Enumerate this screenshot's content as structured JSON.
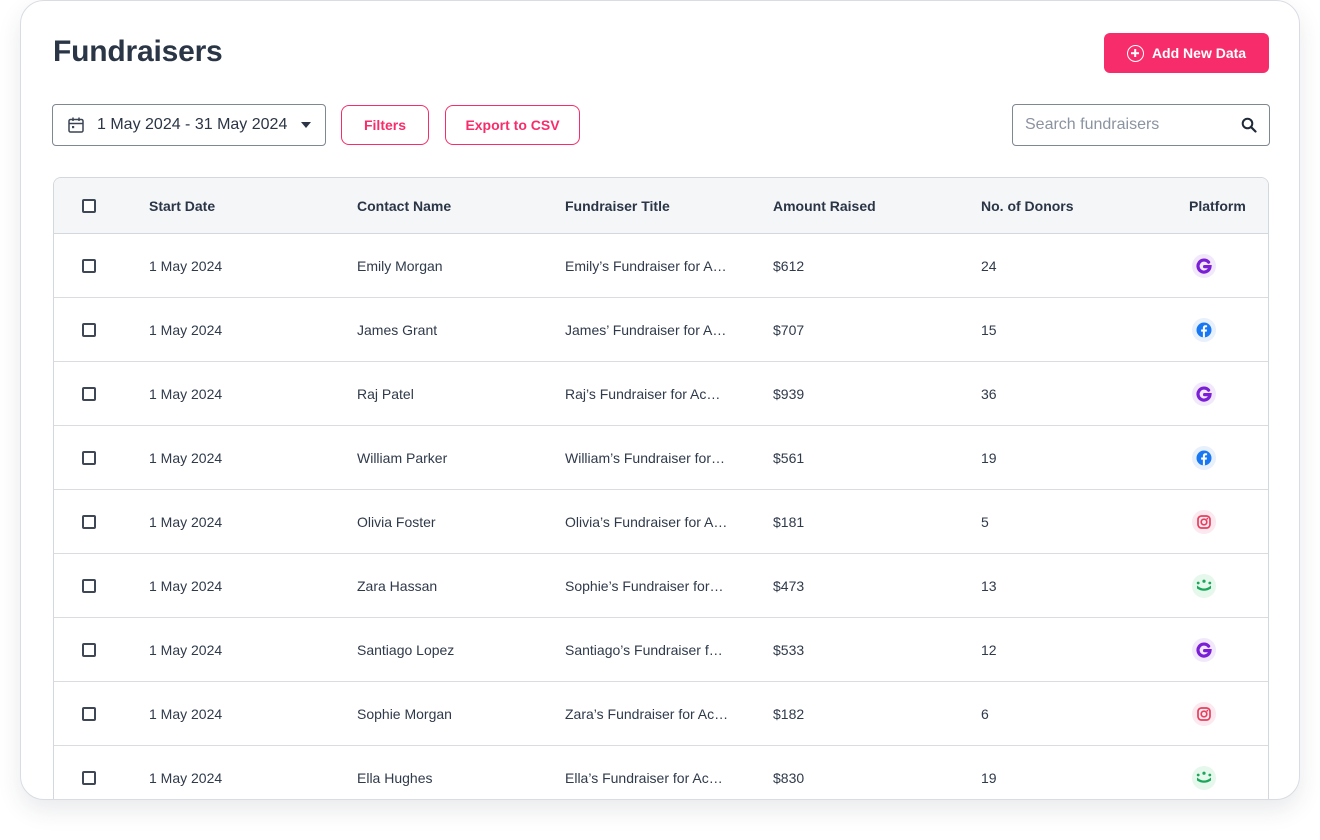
{
  "header": {
    "title": "Fundraisers",
    "add_button_label": "Add New Data"
  },
  "toolbar": {
    "date_range": "1 May 2024 - 31 May 2024",
    "filters_label": "Filters",
    "export_label": "Export to CSV",
    "search_placeholder": "Search fundraisers"
  },
  "colors": {
    "accent": "#f72d6b",
    "gofundme": "#7a1fd6",
    "facebook": "#1877f2",
    "instagram": "#e4405f",
    "justgiving": "#1aa75b"
  },
  "table": {
    "columns": [
      "Start Date",
      "Contact Name",
      "Fundraiser Title",
      "Amount Raised",
      "No. of Donors",
      "Platform"
    ],
    "rows": [
      {
        "start_date": "1 May 2024",
        "contact": "Emily Morgan",
        "title": "Emily’s Fundraiser for A…",
        "amount": "$612",
        "donors": "24",
        "platform": "gofundme-icon"
      },
      {
        "start_date": "1 May 2024",
        "contact": "James Grant",
        "title": "James’ Fundraiser for A…",
        "amount": "$707",
        "donors": "15",
        "platform": "facebook-icon"
      },
      {
        "start_date": "1 May 2024",
        "contact": "Raj Patel",
        "title": "Raj’s Fundraiser for Acm…",
        "amount": "$939",
        "donors": "36",
        "platform": "gofundme-icon"
      },
      {
        "start_date": "1 May 2024",
        "contact": "William Parker",
        "title": "William’s Fundraiser for…",
        "amount": "$561",
        "donors": "19",
        "platform": "facebook-icon"
      },
      {
        "start_date": "1 May 2024",
        "contact": "Olivia Foster",
        "title": "Olivia’s Fundraiser for A…",
        "amount": "$181",
        "donors": "5",
        "platform": "instagram-icon"
      },
      {
        "start_date": "1 May 2024",
        "contact": "Zara Hassan",
        "title": "Sophie’s Fundraiser for…",
        "amount": "$473",
        "donors": "13",
        "platform": "justgiving-icon"
      },
      {
        "start_date": "1 May 2024",
        "contact": "Santiago Lopez",
        "title": "Santiago’s Fundraiser fo…",
        "amount": "$533",
        "donors": "12",
        "platform": "gofundme-icon"
      },
      {
        "start_date": "1 May 2024",
        "contact": "Sophie Morgan",
        "title": "Zara’s Fundraiser for Ac…",
        "amount": "$182",
        "donors": "6",
        "platform": "instagram-icon"
      },
      {
        "start_date": "1 May 2024",
        "contact": "Ella Hughes",
        "title": "Ella’s Fundraiser for Ac…",
        "amount": "$830",
        "donors": "19",
        "platform": "justgiving-icon"
      }
    ]
  }
}
